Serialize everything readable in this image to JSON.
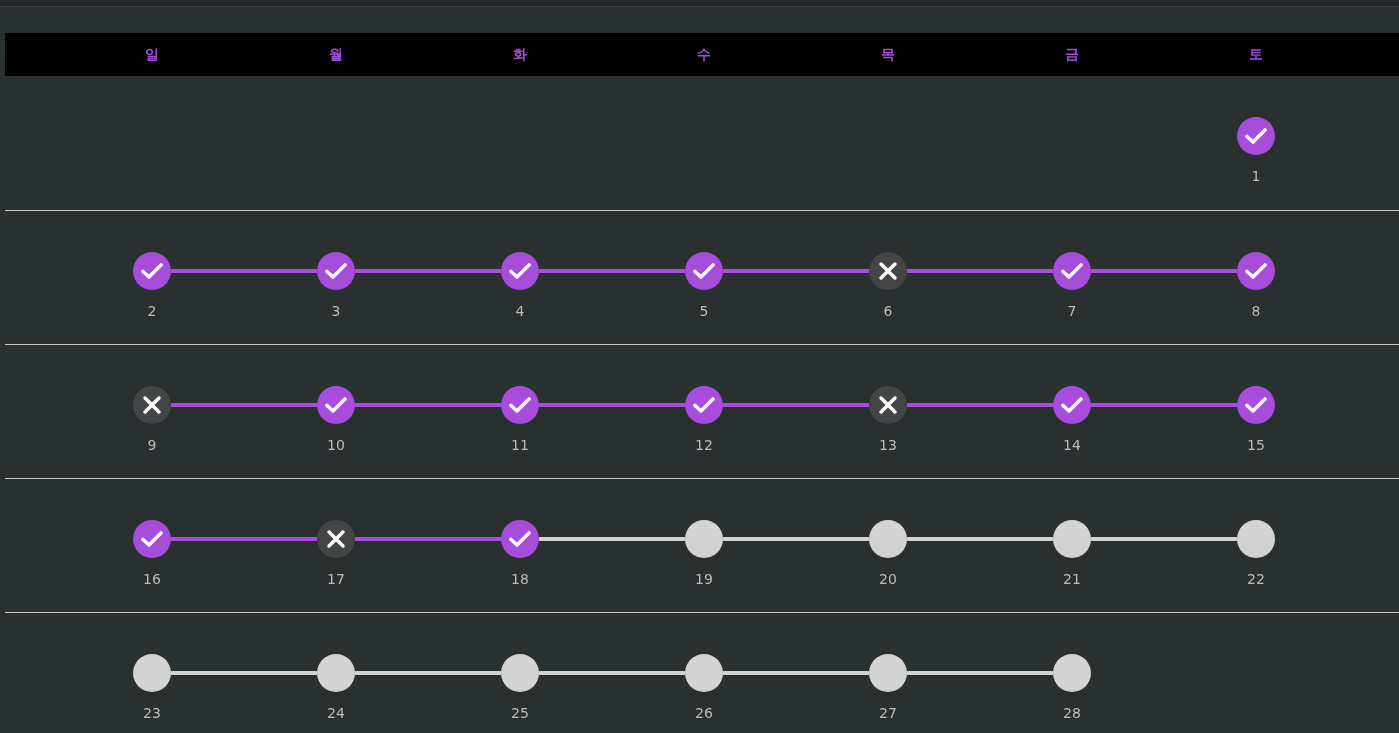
{
  "weekdays": [
    {
      "label": "일"
    },
    {
      "label": "월"
    },
    {
      "label": "화"
    },
    {
      "label": "수"
    },
    {
      "label": "목"
    },
    {
      "label": "금"
    },
    {
      "label": "토"
    }
  ],
  "weeks": [
    {
      "days": [
        {
          "kind": "blank"
        },
        {
          "kind": "blank"
        },
        {
          "kind": "blank"
        },
        {
          "kind": "blank"
        },
        {
          "kind": "blank"
        },
        {
          "kind": "blank"
        },
        {
          "kind": "done",
          "number": "1"
        }
      ]
    },
    {
      "days": [
        {
          "kind": "done",
          "number": "2"
        },
        {
          "kind": "done",
          "number": "3"
        },
        {
          "kind": "done",
          "number": "4"
        },
        {
          "kind": "done",
          "number": "5"
        },
        {
          "kind": "missed",
          "number": "6"
        },
        {
          "kind": "done",
          "number": "7"
        },
        {
          "kind": "done",
          "number": "8"
        }
      ]
    },
    {
      "days": [
        {
          "kind": "missed",
          "number": "9"
        },
        {
          "kind": "done",
          "number": "10"
        },
        {
          "kind": "done",
          "number": "11"
        },
        {
          "kind": "done",
          "number": "12"
        },
        {
          "kind": "missed",
          "number": "13"
        },
        {
          "kind": "done",
          "number": "14"
        },
        {
          "kind": "done",
          "number": "15"
        }
      ]
    },
    {
      "days": [
        {
          "kind": "done",
          "number": "16"
        },
        {
          "kind": "missed",
          "number": "17"
        },
        {
          "kind": "done",
          "number": "18"
        },
        {
          "kind": "pending",
          "number": "19"
        },
        {
          "kind": "pending",
          "number": "20"
        },
        {
          "kind": "pending",
          "number": "21"
        },
        {
          "kind": "pending",
          "number": "22"
        }
      ]
    },
    {
      "days": [
        {
          "kind": "pending",
          "number": "23"
        },
        {
          "kind": "pending",
          "number": "24"
        },
        {
          "kind": "pending",
          "number": "25"
        },
        {
          "kind": "pending",
          "number": "26"
        },
        {
          "kind": "pending",
          "number": "27"
        },
        {
          "kind": "pending",
          "number": "28"
        },
        {
          "kind": "blank"
        }
      ]
    }
  ]
}
